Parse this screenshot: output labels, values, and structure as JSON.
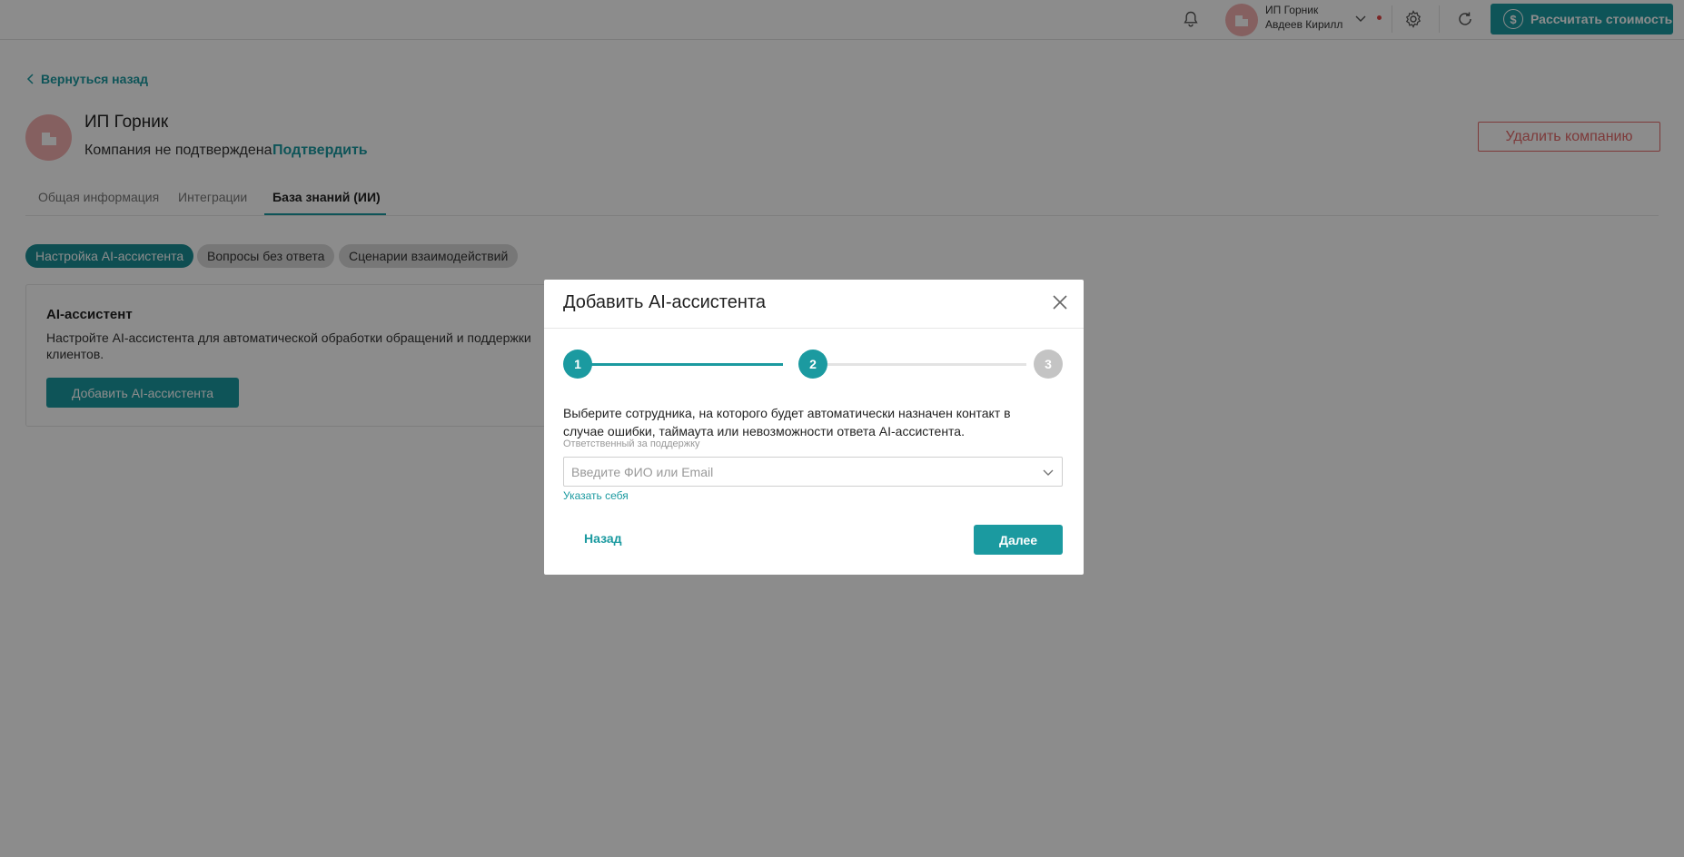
{
  "header": {
    "account_company": "ИП Горник",
    "account_user": "Авдеев Кирилл",
    "calc_button": "Рассчитать стоимость",
    "calc_icon_symbol": "$"
  },
  "page": {
    "back_link": "Вернуться назад",
    "company_name": "ИП Горник",
    "company_status": "Компания не подтверждена",
    "confirm_link": "Подтвердить",
    "delete_button": "Удалить компанию"
  },
  "tabs": [
    {
      "label": "Общая информация",
      "active": false
    },
    {
      "label": "Интеграции",
      "active": false
    },
    {
      "label": "База знаний (ИИ)",
      "active": true
    }
  ],
  "chips": [
    {
      "label": "Настройка AI-ассистента",
      "active": true
    },
    {
      "label": "Вопросы без ответа",
      "active": false
    },
    {
      "label": "Сценарии взаимодействий",
      "active": false
    }
  ],
  "card": {
    "title": "AI-ассистент",
    "description": "Настройте AI-ассистента для автоматической обработки обращений и поддержки клиентов.",
    "button": "Добавить AI-ассистента"
  },
  "modal": {
    "title": "Добавить AI-ассистента",
    "steps": [
      {
        "number": "1",
        "state": "done"
      },
      {
        "number": "2",
        "state": "current"
      },
      {
        "number": "3",
        "state": "pending"
      }
    ],
    "description": "Выберите сотрудника, на которого будет автоматически назначен контакт в случае ошибки, таймаута или невозможности ответа AI-ассистента.",
    "field_label": "Ответственный за поддержку",
    "field_placeholder": "Введите ФИО или Email",
    "self_link": "Указать себя",
    "back_button": "Назад",
    "next_button": "Далее"
  },
  "colors": {
    "accent": "#1b9aa0",
    "danger": "#e46a6a",
    "step_pending": "#c4c4c4",
    "overlay": "rgba(0,0,0,0.45)"
  }
}
